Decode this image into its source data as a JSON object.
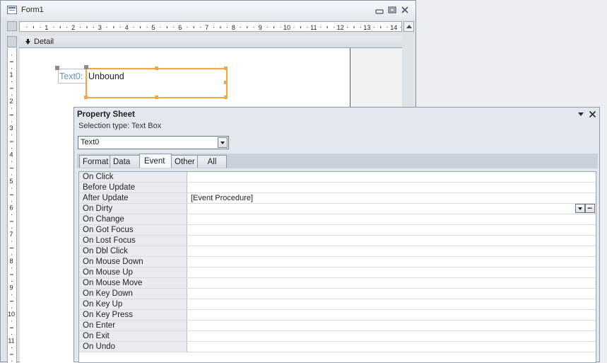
{
  "form_window": {
    "title": "Form1",
    "section_label": "Detail",
    "ruler_h": [
      "1",
      "2",
      "3",
      "4",
      "5",
      "6",
      "7",
      "8",
      "9",
      "10",
      "11",
      "12",
      "13",
      "14"
    ],
    "ruler_v": [
      "1",
      "2",
      "3",
      "4",
      "5",
      "6",
      "7",
      "8",
      "9",
      "10",
      "11"
    ],
    "text_label": "Text0:",
    "text_box_value": "Unbound"
  },
  "property_sheet": {
    "title": "Property Sheet",
    "selection_type": "Selection type:  Text Box",
    "selected_control": "Text0",
    "tabs": [
      {
        "label": "Format"
      },
      {
        "label": "Data"
      },
      {
        "label": "Event"
      },
      {
        "label": "Other"
      },
      {
        "label": "All"
      }
    ],
    "active_tab": "Event",
    "rows": [
      {
        "label": "On Click",
        "value": ""
      },
      {
        "label": "Before Update",
        "value": ""
      },
      {
        "label": "After Update",
        "value": "[Event Procedure]"
      },
      {
        "label": "On Dirty",
        "value": ""
      },
      {
        "label": "On Change",
        "value": ""
      },
      {
        "label": "On Got Focus",
        "value": ""
      },
      {
        "label": "On Lost Focus",
        "value": ""
      },
      {
        "label": "On Dbl Click",
        "value": ""
      },
      {
        "label": "On Mouse Down",
        "value": ""
      },
      {
        "label": "On Mouse Up",
        "value": ""
      },
      {
        "label": "On Mouse Move",
        "value": ""
      },
      {
        "label": "On Key Down",
        "value": ""
      },
      {
        "label": "On Key Up",
        "value": ""
      },
      {
        "label": "On Key Press",
        "value": ""
      },
      {
        "label": "On Enter",
        "value": ""
      },
      {
        "label": "On Exit",
        "value": ""
      },
      {
        "label": "On Undo",
        "value": ""
      }
    ],
    "build_button_label": "..."
  },
  "colors": {
    "selection_orange": "#f2a93b",
    "label_blue": "#6a8fb9"
  }
}
